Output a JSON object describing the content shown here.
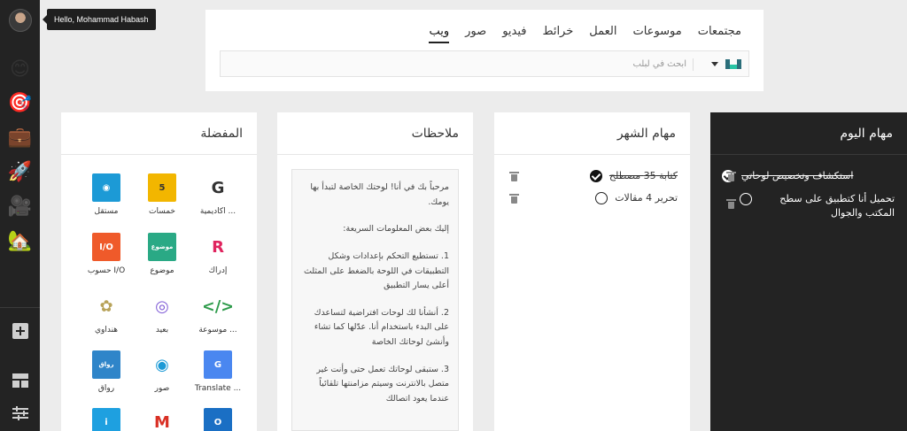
{
  "user": {
    "greeting": "Hello, Mohammad Habash"
  },
  "sidebar": {
    "apps": [
      {
        "icon": "smiley-emoji-icon",
        "glyph": "😊"
      },
      {
        "icon": "target-emoji-icon",
        "glyph": "🎯"
      },
      {
        "icon": "briefcase-emoji-icon",
        "glyph": "💼"
      },
      {
        "icon": "rocket-emoji-icon",
        "glyph": "🚀"
      },
      {
        "icon": "movie-camera-emoji-icon",
        "glyph": "🎥"
      },
      {
        "icon": "house-emoji-icon",
        "glyph": "🏡"
      }
    ],
    "tools": [
      {
        "icon": "add-icon",
        "glyph": "+"
      },
      {
        "icon": "layout-icon",
        "glyph": "▦"
      },
      {
        "icon": "settings-sliders-icon",
        "glyph": "☰"
      }
    ]
  },
  "search": {
    "tabs": [
      "ويب",
      "صور",
      "فيديو",
      "خرائط",
      "العمل",
      "موسوعات",
      "مجتمعات"
    ],
    "active_tab": "ويب",
    "placeholder": "ابحث في لبلب",
    "engine_icon": "lablab-logo-icon"
  },
  "today": {
    "title": "مهام اليوم",
    "tasks": [
      {
        "text": "استكشاف وتخصيص لوحاتي",
        "done": true
      },
      {
        "text": "تحميل أنا كتطبيق على سطح المكتب والجوال",
        "done": false
      }
    ]
  },
  "month": {
    "title": "مهام الشهر",
    "tasks": [
      {
        "text": "كتابة 35 مصطلح",
        "done": true
      },
      {
        "text": "تحرير 4 مقالات",
        "done": false
      }
    ]
  },
  "notes": {
    "title": "ملاحظات",
    "paragraphs": [
      "مرحباً بك في أنا! لوحتك الخاصة لتبدأ بها يومك.",
      "إليك بعض المعلومات السريعة:",
      "1. تستطيع التحكم بإعدادات وشكل التطبيقات في اللوحة بالضغط على المثلث أعلى يسار التطبيق",
      "2. أنشأنا لك لوحات افتراضية لتساعدك على البدء باستخدام أنا. عدّلها كما تشاء وأنشئ لوحاتك الخاصة",
      "3. ستبقى لوحاتك تعمل حتى وأنت غير متصل بالانترنت وسيتم مزامنتها تلقائياً عندما يعود اتصالك"
    ]
  },
  "favorites": {
    "title": "المفضلة",
    "items": [
      {
        "label": "أكاديمية ...",
        "icon": "academy-logo-icon",
        "bg": "#ffffff",
        "fg": "#333333",
        "glyph": "G"
      },
      {
        "label": "خمسات",
        "icon": "khamsat-logo-icon",
        "bg": "#f2b600",
        "fg": "#333333",
        "glyph": "5"
      },
      {
        "label": "مستقل",
        "icon": "mostaql-logo-icon",
        "bg": "#1c9ad6",
        "fg": "#ffffff",
        "glyph": "◉"
      },
      {
        "label": "إدراك",
        "icon": "edraak-logo-icon",
        "bg": "#ffffff",
        "fg": "#e0245e",
        "glyph": "R"
      },
      {
        "label": "موضوع",
        "icon": "mawdoo3-logo-icon",
        "bg": "#2aa985",
        "fg": "#ffffff",
        "glyph": "موضوع"
      },
      {
        "label": "حسوب I/O",
        "icon": "hsoub-io-logo-icon",
        "bg": "#ef5a2a",
        "fg": "#ffffff",
        "glyph": "I/O"
      },
      {
        "label": "موسوعة ...",
        "icon": "encyclopedia-logo-icon",
        "bg": "#ffffff",
        "fg": "#2e9b4b",
        "glyph": "</>"
      },
      {
        "label": "بعيد",
        "icon": "baeed-logo-icon",
        "bg": "#ffffff",
        "fg": "#7f5bd6",
        "glyph": "◎"
      },
      {
        "label": "هنداوي",
        "icon": "hindawi-logo-icon",
        "bg": "#ffffff",
        "fg": "#b8a35a",
        "glyph": "✿"
      },
      {
        "label": "Translate ...",
        "icon": "google-translate-logo-icon",
        "bg": "#4a87f0",
        "fg": "#ffffff",
        "glyph": "G"
      },
      {
        "label": "صور",
        "icon": "photos-logo-icon",
        "bg": "#ffffff",
        "fg": "#1c9ad6",
        "glyph": "◉"
      },
      {
        "label": "رواق",
        "icon": "rwaq-logo-icon",
        "bg": "#2f85c9",
        "fg": "#ffffff",
        "glyph": "رواق"
      },
      {
        "label": "",
        "icon": "outlook-logo-icon",
        "bg": "#1a6fc4",
        "fg": "#ffffff",
        "glyph": "O"
      },
      {
        "label": "",
        "icon": "gmail-logo-icon",
        "bg": "#ffffff",
        "fg": "#d93025",
        "glyph": "M"
      },
      {
        "label": "",
        "icon": "info-logo-icon",
        "bg": "#1ea0e0",
        "fg": "#ffffff",
        "glyph": "i"
      }
    ]
  }
}
